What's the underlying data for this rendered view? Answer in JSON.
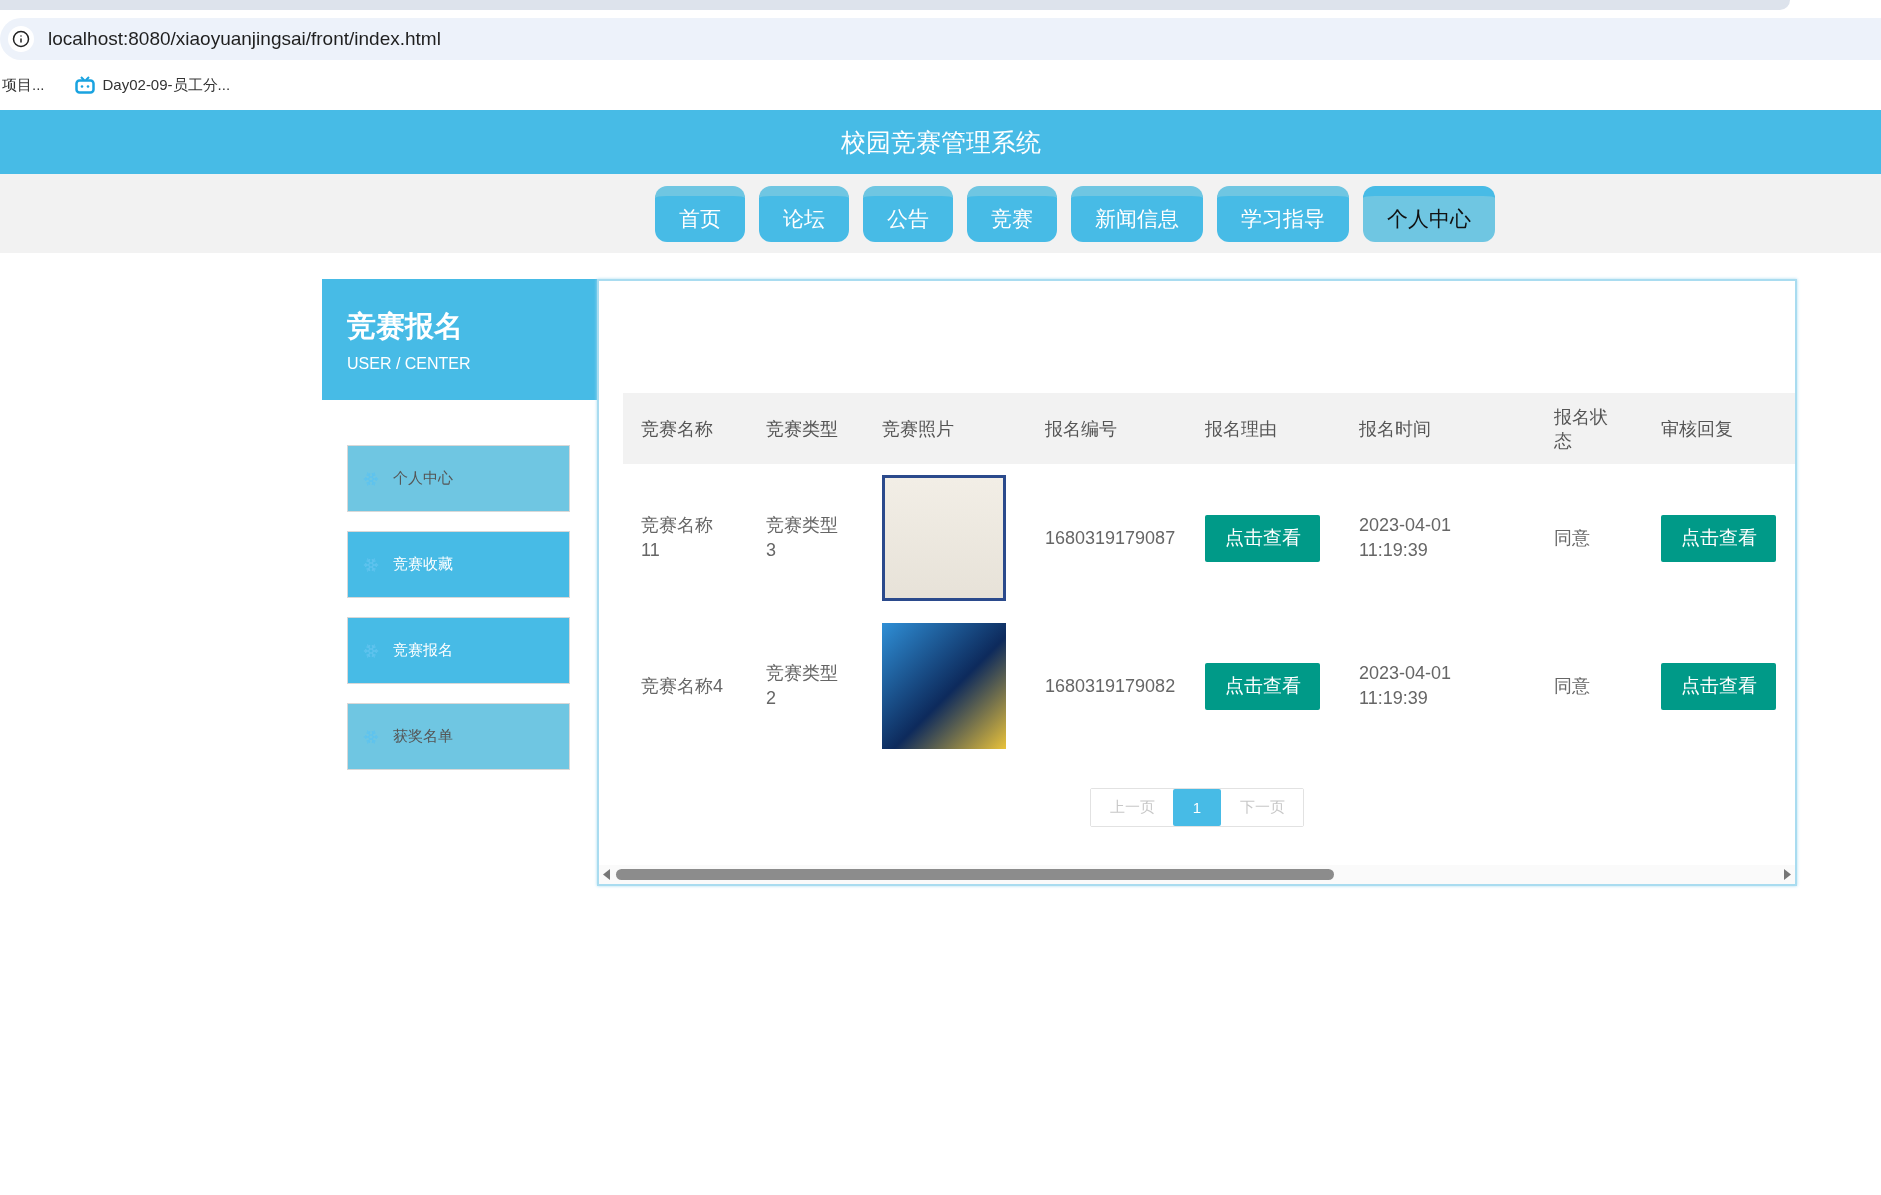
{
  "browser": {
    "address": "localhost:8080/xiaoyuanjingsai/front/index.html",
    "bookmarks": [
      {
        "label": "项目...",
        "kind": "plain"
      },
      {
        "label": "Day02-09-员工分...",
        "kind": "tv"
      }
    ]
  },
  "header": {
    "title": "校园竞赛管理系统"
  },
  "nav": [
    {
      "label": "首页",
      "selected": false
    },
    {
      "label": "论坛",
      "selected": false
    },
    {
      "label": "公告",
      "selected": false
    },
    {
      "label": "竞赛",
      "selected": false
    },
    {
      "label": "新闻信息",
      "selected": false
    },
    {
      "label": "学习指导",
      "selected": false
    },
    {
      "label": "个人中心",
      "selected": true
    }
  ],
  "sidebar": {
    "title": "竞赛报名",
    "subtitle": "USER / CENTER",
    "items": [
      {
        "label": "个人中心",
        "active": false
      },
      {
        "label": "竞赛收藏",
        "active": true
      },
      {
        "label": "竞赛报名",
        "active": true
      },
      {
        "label": "获奖名单",
        "active": false
      }
    ]
  },
  "table": {
    "columns": [
      "竞赛名称",
      "竞赛类型",
      "竞赛照片",
      "报名编号",
      "报名理由",
      "报名时间",
      "报名状态",
      "审核回复"
    ],
    "rows": [
      {
        "name": "竞赛名称11",
        "type": "竞赛类型3",
        "kind": "certificate",
        "reg_no": "1680319179087",
        "reason_button": "点击查看",
        "time": "2023-04-01 11:19:39",
        "status": "同意",
        "reply_button": "点击查看"
      },
      {
        "name": "竞赛名称4",
        "type": "竞赛类型2",
        "kind": "poster",
        "reg_no": "1680319179082",
        "reason_button": "点击查看",
        "time": "2023-04-01 11:19:39",
        "status": "同意",
        "reply_button": "点击查看"
      }
    ]
  },
  "pagination": {
    "prev": "上一页",
    "pages": [
      {
        "label": "1",
        "selected": true
      }
    ],
    "next": "下一页"
  }
}
